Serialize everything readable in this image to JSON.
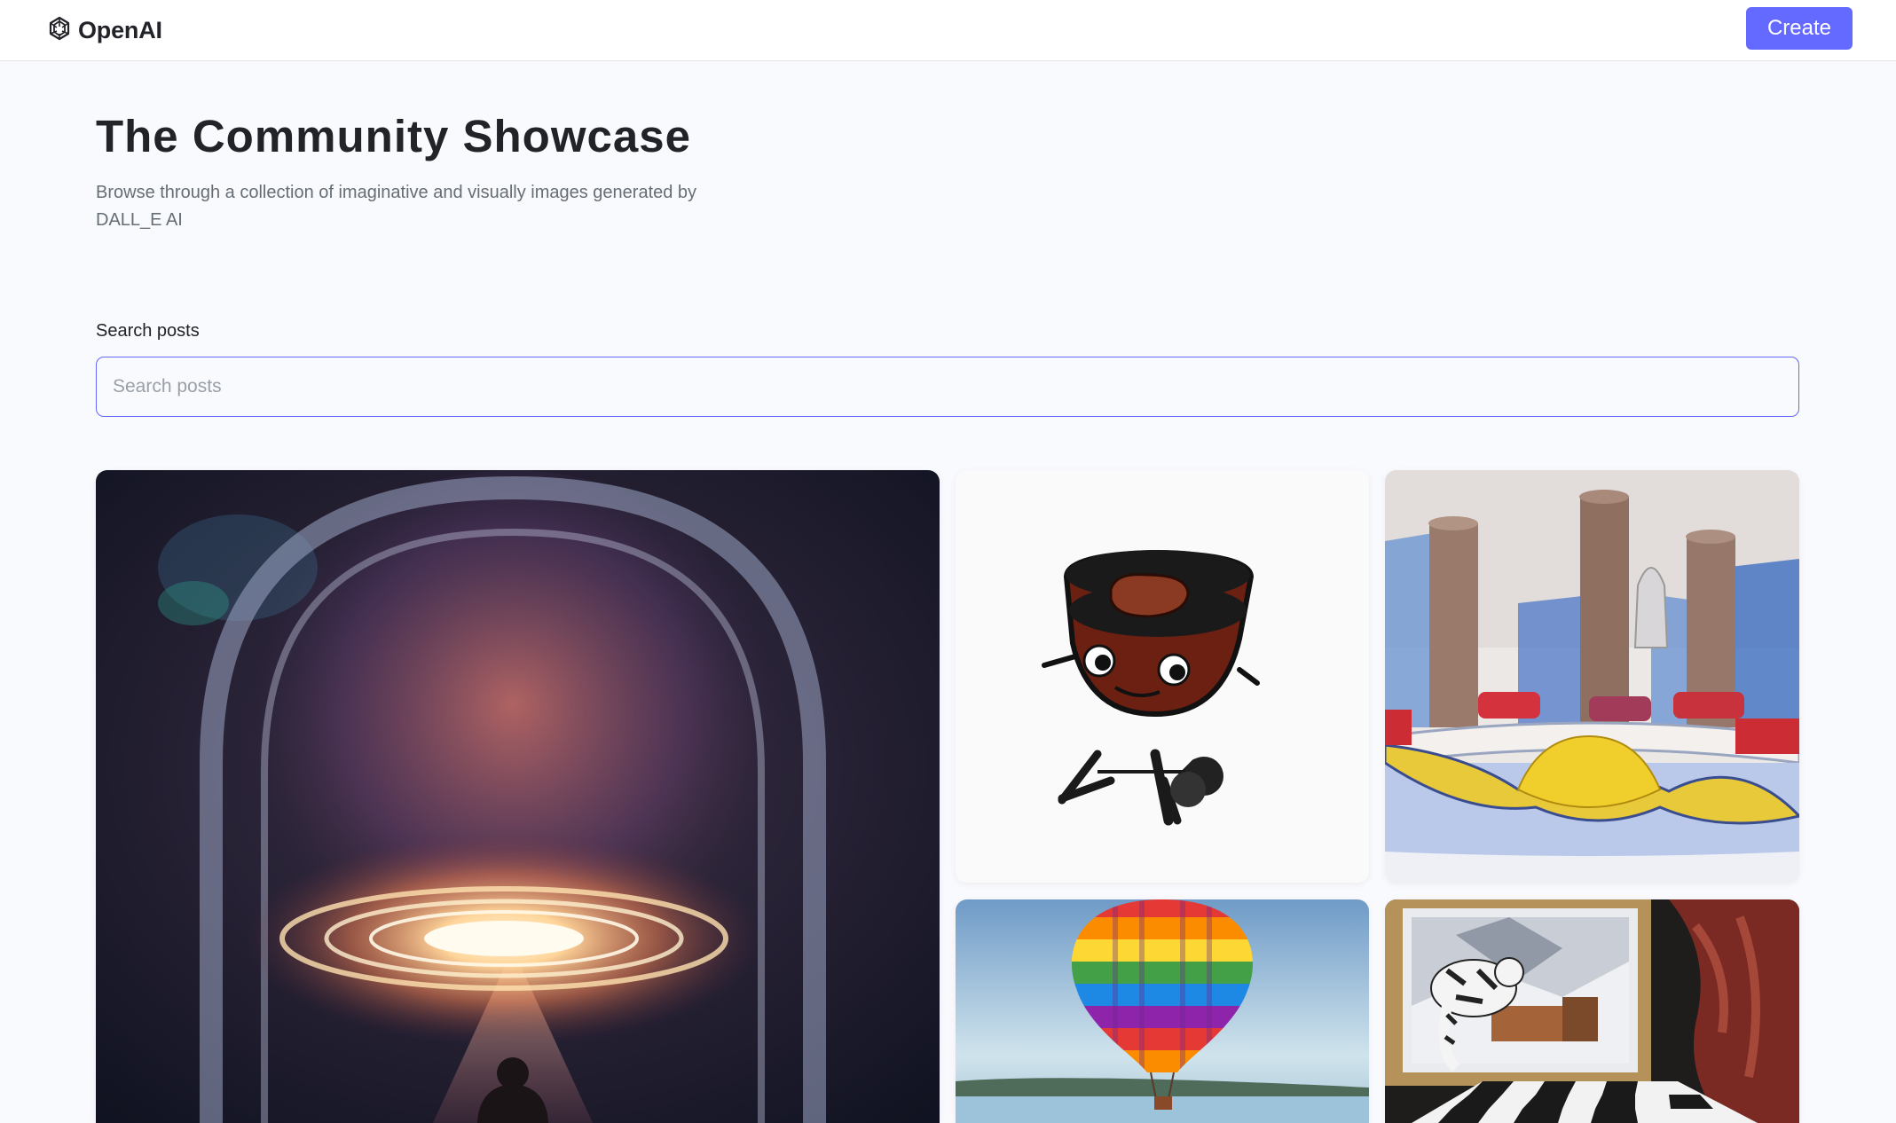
{
  "header": {
    "brand": "OpenAI",
    "brand_icon": "openai-logo-icon",
    "create_label": "Create"
  },
  "hero": {
    "title": "The Community Showcase",
    "subtitle": "Browse through a collection of imaginative and visually images generated by DALL_E AI"
  },
  "search": {
    "label": "Search posts",
    "placeholder": "Search posts",
    "value": ""
  },
  "gallery": {
    "cards": [
      {
        "name": "cosmic-portal-image"
      },
      {
        "name": "grill-character-image"
      },
      {
        "name": "city-bridge-sketch-image"
      },
      {
        "name": "rainbow-balloon-image"
      },
      {
        "name": "cat-chessboard-painting-image"
      }
    ]
  },
  "colors": {
    "accent": "#6469ff",
    "title": "#222328",
    "subtitle": "#666e75",
    "background": "#f9fafe"
  }
}
